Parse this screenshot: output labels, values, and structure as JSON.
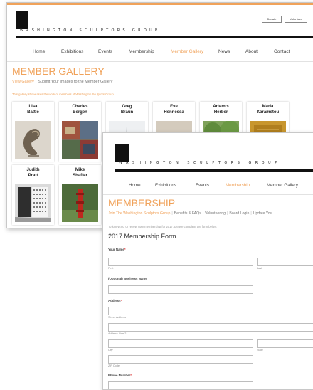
{
  "gallery_window": {
    "logo_text": "WASHINGTON SCULPTORS GROUP",
    "header_buttons": [
      "Donate",
      "Volunteer"
    ],
    "nav": [
      {
        "label": "Home",
        "active": false
      },
      {
        "label": "Exhibitions",
        "active": false
      },
      {
        "label": "Events",
        "active": false
      },
      {
        "label": "Membership",
        "active": false
      },
      {
        "label": "Member Gallery",
        "active": true
      },
      {
        "label": "News",
        "active": false
      },
      {
        "label": "About",
        "active": false
      },
      {
        "label": "Contact",
        "active": false
      }
    ],
    "title": "MEMBER GALLERY",
    "sub_links": [
      "View Gallery",
      "Submit Your Images to the Member Gallery"
    ],
    "description": "This gallery showcases the work of members of Washington Sculptors Group",
    "artists": [
      {
        "first": "Lisa",
        "last": "Battle"
      },
      {
        "first": "Charles",
        "last": "Bergen"
      },
      {
        "first": "Greg",
        "last": "Braun"
      },
      {
        "first": "Eve",
        "last": "Hennessa"
      },
      {
        "first": "Artemis",
        "last": "Herber"
      },
      {
        "first": "Maria",
        "last": "Karametou"
      },
      {
        "first": "Judith",
        "last": "Pratt"
      },
      {
        "first": "Mike",
        "last": "Shaffer"
      }
    ]
  },
  "membership_window": {
    "logo_text": "WASHINGTON SCULPTORS GROUP",
    "nav": [
      {
        "label": "Home",
        "active": false
      },
      {
        "label": "Exhibitions",
        "active": false
      },
      {
        "label": "Events",
        "active": false
      },
      {
        "label": "Membership",
        "active": true
      },
      {
        "label": "Member Gallery",
        "active": false
      }
    ],
    "title": "MEMBERSHIP",
    "sub_links": [
      "Join The Washington Sculptors Group",
      "Benefits & FAQs",
      "Volunteering",
      "Board Login",
      "Update You"
    ],
    "intro": "To join WSG or renew your membership for 2017, please complete the form below.",
    "form_title": "2017 Membership Form",
    "fields": {
      "name_label": "Your Name",
      "first_sub": "First",
      "last_sub": "Last",
      "business_label": "(Optional) Business Name",
      "address_label": "Address",
      "street_sub": "Street Address",
      "line2_sub": "Address Line 2",
      "city_sub": "City",
      "state_sub": "State",
      "zip_sub": "ZIP Code",
      "phone_label": "Phone Number"
    },
    "required_mark": "*"
  },
  "colors": {
    "accent": "#f0a25a",
    "logo": "#111111"
  }
}
